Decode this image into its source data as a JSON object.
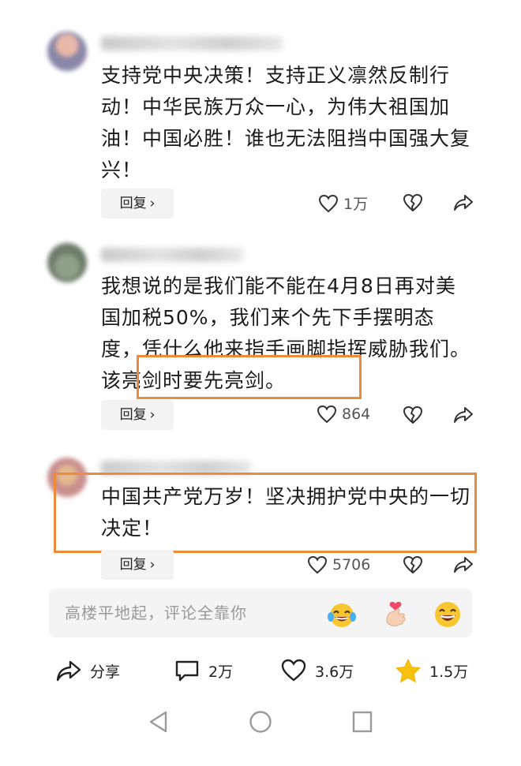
{
  "comments": [
    {
      "text": "支持党中央决策！支持正义凛然反制行动！中华民族万众一心，为伟大祖国加油！中国必胜！谁也无法阻挡中国强大复兴！",
      "reply_label": "回复",
      "like_count": "1万"
    },
    {
      "text": "我想说的是我们能不能在4月8日再对美国加税50%，我们来个先下手摆明态度，凭什么他来指手画脚指挥威胁我们。该亮剑时要先亮剑。",
      "reply_label": "回复",
      "like_count": "864"
    },
    {
      "text": "中国共产党万岁！坚决拥护党中央的一切决定！",
      "reply_label": "回复",
      "like_count": "5706"
    }
  ],
  "input": {
    "placeholder": "高楼平地起，评论全靠你"
  },
  "emojis": [
    "laughing-crying-emoji",
    "finger-heart-emoji",
    "grinning-emoji"
  ],
  "bottom_bar": {
    "share_label": "分享",
    "comment_count": "2万",
    "like_count": "3.6万",
    "favorite_count": "1.5万"
  },
  "colors": {
    "highlight": "#ec8b3c",
    "star": "#f7c20f"
  },
  "icons": [
    "heart-icon",
    "broken-heart-icon",
    "share-icon",
    "comment-icon",
    "star-icon",
    "back-nav-icon",
    "home-nav-icon",
    "recents-nav-icon"
  ]
}
